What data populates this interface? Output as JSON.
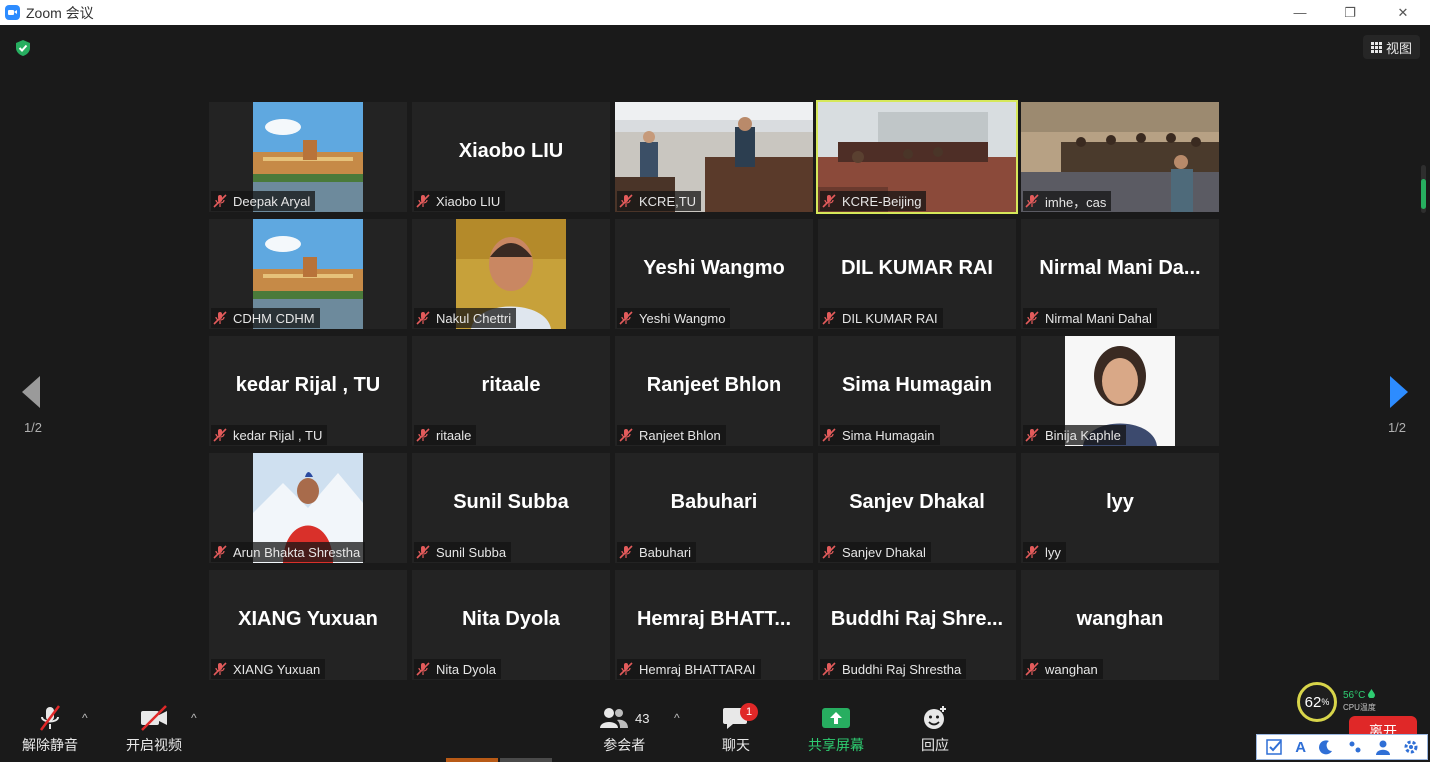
{
  "window": {
    "title": "Zoom 会议",
    "minimize": "—",
    "restore": "❐",
    "close": "✕"
  },
  "header": {
    "view_label": "视图"
  },
  "pagination": {
    "left": "1/2",
    "right": "1/2"
  },
  "tiles": [
    {
      "name": "Deepak Aryal",
      "big": "",
      "kind": "building"
    },
    {
      "name": "Xiaobo LIU",
      "big": "Xiaobo LIU",
      "kind": "text"
    },
    {
      "name": "KCRE,TU",
      "big": "",
      "kind": "room1"
    },
    {
      "name": "KCRE-Beijing",
      "big": "",
      "kind": "room2"
    },
    {
      "name": "imhe，cas",
      "big": "",
      "kind": "room3"
    },
    {
      "name": "CDHM CDHM",
      "big": "",
      "kind": "building"
    },
    {
      "name": "Nakul Chettri",
      "big": "",
      "kind": "man"
    },
    {
      "name": "Yeshi Wangmo",
      "big": "Yeshi Wangmo",
      "kind": "text"
    },
    {
      "name": "DIL KUMAR RAI",
      "big": "DIL KUMAR RAI",
      "kind": "text"
    },
    {
      "name": "Nirmal Mani Dahal",
      "big": "Nirmal  Mani  Da...",
      "kind": "text"
    },
    {
      "name": "kedar Rijal , TU",
      "big": "kedar Rijal , TU",
      "kind": "text"
    },
    {
      "name": "ritaale",
      "big": "ritaale",
      "kind": "text"
    },
    {
      "name": "Ranjeet Bhlon",
      "big": "Ranjeet Bhlon",
      "kind": "text"
    },
    {
      "name": "Sima Humagain",
      "big": "Sima Humagain",
      "kind": "text"
    },
    {
      "name": "Binija Kaphle",
      "big": "",
      "kind": "woman"
    },
    {
      "name": "Arun Bhakta Shrestha",
      "big": "",
      "kind": "snow"
    },
    {
      "name": "Sunil Subba",
      "big": "Sunil Subba",
      "kind": "text"
    },
    {
      "name": "Babuhari",
      "big": "Babuhari",
      "kind": "text"
    },
    {
      "name": "Sanjev Dhakal",
      "big": "Sanjev Dhakal",
      "kind": "text"
    },
    {
      "name": "lyy",
      "big": "lyy",
      "kind": "text"
    },
    {
      "name": "XIANG Yuxuan",
      "big": "XIANG Yuxuan",
      "kind": "text"
    },
    {
      "name": "Nita Dyola",
      "big": "Nita Dyola",
      "kind": "text"
    },
    {
      "name": "Hemraj BHATTARAI",
      "big": "Hemraj  BHATT...",
      "kind": "text"
    },
    {
      "name": "Buddhi Raj Shrestha",
      "big": "Buddhi  Raj  Shre...",
      "kind": "text"
    },
    {
      "name": "wanghan",
      "big": "wanghan",
      "kind": "text"
    }
  ],
  "toolbar": {
    "unmute": "解除静音",
    "start_video": "开启视频",
    "participants": "参会者",
    "participant_count": "43",
    "chat": "聊天",
    "chat_badge": "1",
    "share": "共享屏幕",
    "reactions": "回应",
    "caret": "^"
  },
  "cpu": {
    "percent": "62",
    "percent_unit": "%",
    "temp": "56°C",
    "temp_label": "CPU温度"
  },
  "leave": "离开",
  "ime": {
    "a_label": "A"
  },
  "colors": {
    "accent_blue": "#2d8cff",
    "active_outline": "#d6e85a",
    "leave_red": "#e02828",
    "share_green": "#2ecc71"
  }
}
